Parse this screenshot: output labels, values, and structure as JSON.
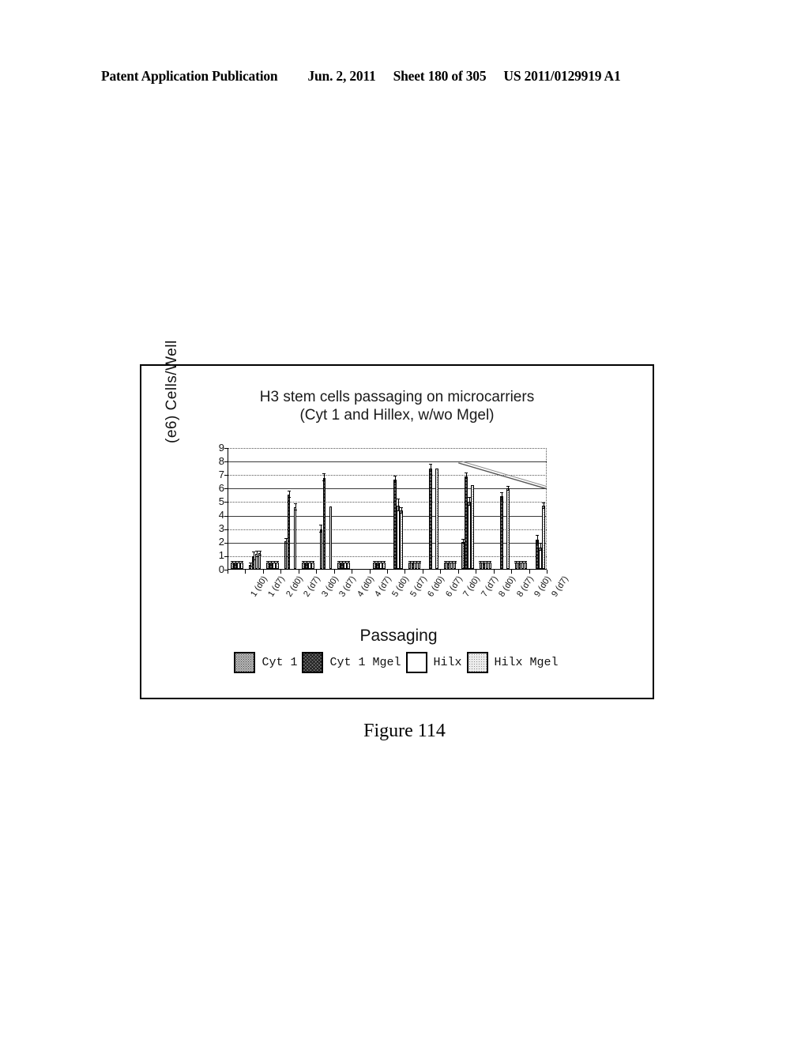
{
  "header": {
    "publication": "Patent Application Publication",
    "date": "Jun. 2, 2011",
    "sheet": "Sheet 180 of 305",
    "number": "US 2011/0129919 A1"
  },
  "figure": {
    "caption": "Figure 114"
  },
  "chart_data": {
    "type": "bar",
    "title": "H3 stem cells passaging on microcarriers",
    "subtitle": "(Cyt 1 and Hillex, w/wo Mgel)",
    "xlabel": "Passaging",
    "ylabel": "(e6) Cells/Well",
    "ylim": [
      0,
      9
    ],
    "yticks": [
      0,
      1,
      2,
      3,
      4,
      5,
      6,
      7,
      8,
      9
    ],
    "grid": true,
    "legend_position": "bottom",
    "categories": [
      "1 (d0)",
      "1 (d7)",
      "2 (d0)",
      "2 (d7)",
      "3 (d0)",
      "3 (d7)",
      "4 (d0)",
      "4 (d7)",
      "5 (d0)",
      "5 (d7)",
      "6 (d0)",
      "6 (d7)",
      "7 (d0)",
      "7 (d7)",
      "8 (d0)",
      "8 (d7)",
      "9 (d0)",
      "9 (d7)"
    ],
    "series": [
      {
        "name": "Cyt 1",
        "key": "cyt1",
        "color": "#b9b9b9",
        "values": [
          0.45,
          0.3,
          0.45,
          2.05,
          0.45,
          2.95,
          0.45,
          0.0,
          0.45,
          0.0,
          0.45,
          0.0,
          0.45,
          2.0,
          0.45,
          0.0,
          0.45,
          0.0
        ],
        "errors": [
          0.05,
          0.1,
          0.05,
          0.15,
          0.05,
          0.25,
          0.05,
          0.0,
          0.05,
          0.0,
          0.05,
          0.0,
          0.05,
          0.15,
          0.05,
          0.0,
          0.05,
          0.0
        ]
      },
      {
        "name": "Cyt 1 Mgel",
        "key": "cyt1_mgel",
        "color": "#6e6e6e",
        "values": [
          0.45,
          0.95,
          0.45,
          5.5,
          0.45,
          6.75,
          0.45,
          0.0,
          0.45,
          6.6,
          0.45,
          7.45,
          0.45,
          6.85,
          0.45,
          5.35,
          0.45,
          2.15
        ],
        "errors": [
          0.05,
          0.3,
          0.05,
          0.25,
          0.05,
          0.25,
          0.05,
          0.0,
          0.05,
          0.25,
          0.05,
          0.25,
          0.05,
          0.2,
          0.05,
          0.25,
          0.05,
          0.3
        ]
      },
      {
        "name": "Hilx",
        "key": "hilx",
        "color": "#ffffff",
        "values": [
          0.45,
          1.1,
          0.45,
          0.0,
          0.45,
          0.0,
          0.45,
          0.0,
          0.45,
          4.7,
          0.45,
          0.0,
          0.45,
          4.95,
          0.45,
          0.0,
          0.45,
          1.6
        ],
        "errors": [
          0.05,
          0.2,
          0.05,
          0.0,
          0.05,
          0.0,
          0.05,
          0.0,
          0.05,
          0.45,
          0.05,
          0.0,
          0.05,
          0.3,
          0.05,
          0.0,
          0.05,
          0.25
        ]
      },
      {
        "name": "Hilx Mgel",
        "key": "hilx_mgel",
        "color": "#ececec",
        "values": [
          0.45,
          1.15,
          0.45,
          4.55,
          0.45,
          4.6,
          0.45,
          0.0,
          0.45,
          4.3,
          0.45,
          7.4,
          0.45,
          6.2,
          0.45,
          5.95,
          0.45,
          4.65
        ],
        "errors": [
          0.05,
          0.15,
          0.05,
          0.25,
          0.05,
          0.0,
          0.05,
          0.0,
          0.05,
          0.2,
          0.05,
          0.0,
          0.05,
          0.0,
          0.05,
          0.15,
          0.05,
          0.2
        ]
      }
    ]
  }
}
